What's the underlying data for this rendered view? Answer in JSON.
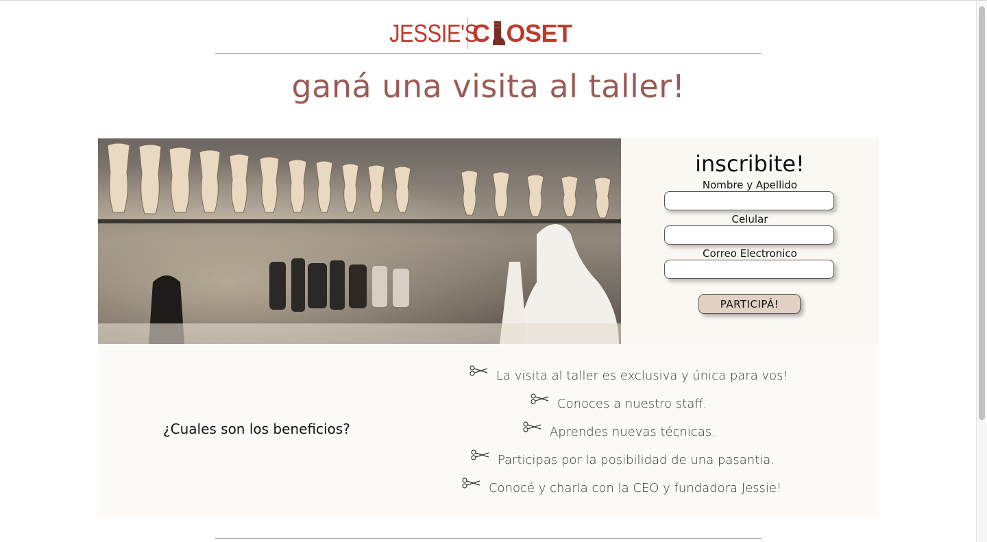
{
  "logo": {
    "part1": "JESSIE'S",
    "part2_a": "C",
    "part2_b": "OSET",
    "boot_icon": "boot-icon"
  },
  "headline": "ganá una visita al taller!",
  "form": {
    "title": "inscribite!",
    "name_label": "Nombre y Apellido",
    "phone_label": "Celular",
    "email_label": "Correo Electronico",
    "name_value": "",
    "phone_value": "",
    "email_value": "",
    "submit_label": "PARTICIPÁ!"
  },
  "benefits": {
    "question": "¿Cuales son los beneficios?",
    "items": [
      "La visita al taller es exclusiva y única para vos!",
      "Conoces a nuestro staff.",
      "Aprendes nuevas técnicas.",
      "Participas por la posibilidad de una pasantia.",
      "Conocé y charla con la CEO y fundadora Jessie!"
    ],
    "icon": "scissors-icon"
  },
  "colors": {
    "brand_red": "#c0392b",
    "headline": "#9a5b55",
    "panel_bg": "#fbf7f2",
    "button_bg": "#e2d1c4"
  }
}
